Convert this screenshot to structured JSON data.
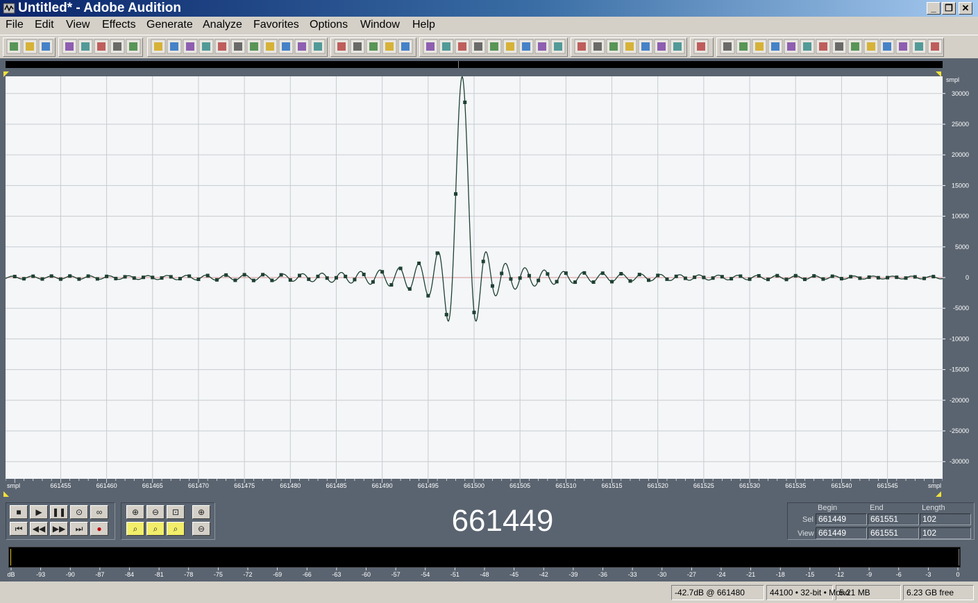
{
  "window": {
    "title": "Untitled* - Adobe Audition"
  },
  "menu": {
    "items": [
      "File",
      "Edit",
      "View",
      "Effects",
      "Generate",
      "Analyze",
      "Favorites",
      "Options",
      "Window",
      "Help"
    ]
  },
  "waveform": {
    "y_axis_unit": "smpl",
    "x_axis_unit": "smpl",
    "y_ticks": [
      "30000",
      "25000",
      "20000",
      "15000",
      "10000",
      "5000",
      "0",
      "-5000",
      "-10000",
      "-15000",
      "-20000",
      "-25000",
      "-30000"
    ],
    "x_ticks": [
      "661455",
      "661460",
      "661465",
      "661470",
      "661475",
      "661480",
      "661485",
      "661490",
      "661495",
      "661500",
      "661505",
      "661510",
      "661515",
      "661520",
      "661525",
      "661530",
      "661535",
      "661540",
      "661545"
    ],
    "peak_sample": 661499,
    "line_color": "#1e4032",
    "background": "#f4f6f8",
    "grid_color": "#c8ccd0"
  },
  "transport": {
    "time_display": "661449"
  },
  "selection": {
    "headers": {
      "begin": "Begin",
      "end": "End",
      "length": "Length"
    },
    "sel": {
      "label": "Sel",
      "begin": "661449",
      "end": "661551",
      "length": "102"
    },
    "view": {
      "label": "View",
      "begin": "661449",
      "end": "661551",
      "length": "102"
    }
  },
  "level_meter": {
    "ticks": [
      "dB",
      "-93",
      "-90",
      "-87",
      "-84",
      "-81",
      "-78",
      "-75",
      "-72",
      "-69",
      "-66",
      "-63",
      "-60",
      "-57",
      "-54",
      "-51",
      "-48",
      "-45",
      "-42",
      "-39",
      "-36",
      "-33",
      "-30",
      "-27",
      "-24",
      "-21",
      "-18",
      "-15",
      "-12",
      "-9",
      "-6",
      "-3",
      "0"
    ]
  },
  "status": {
    "peak": "-42.7dB @ 661480",
    "format": "44100 • 32-bit • Mono",
    "size": "5.21 MB",
    "free": "6.23 GB free"
  }
}
